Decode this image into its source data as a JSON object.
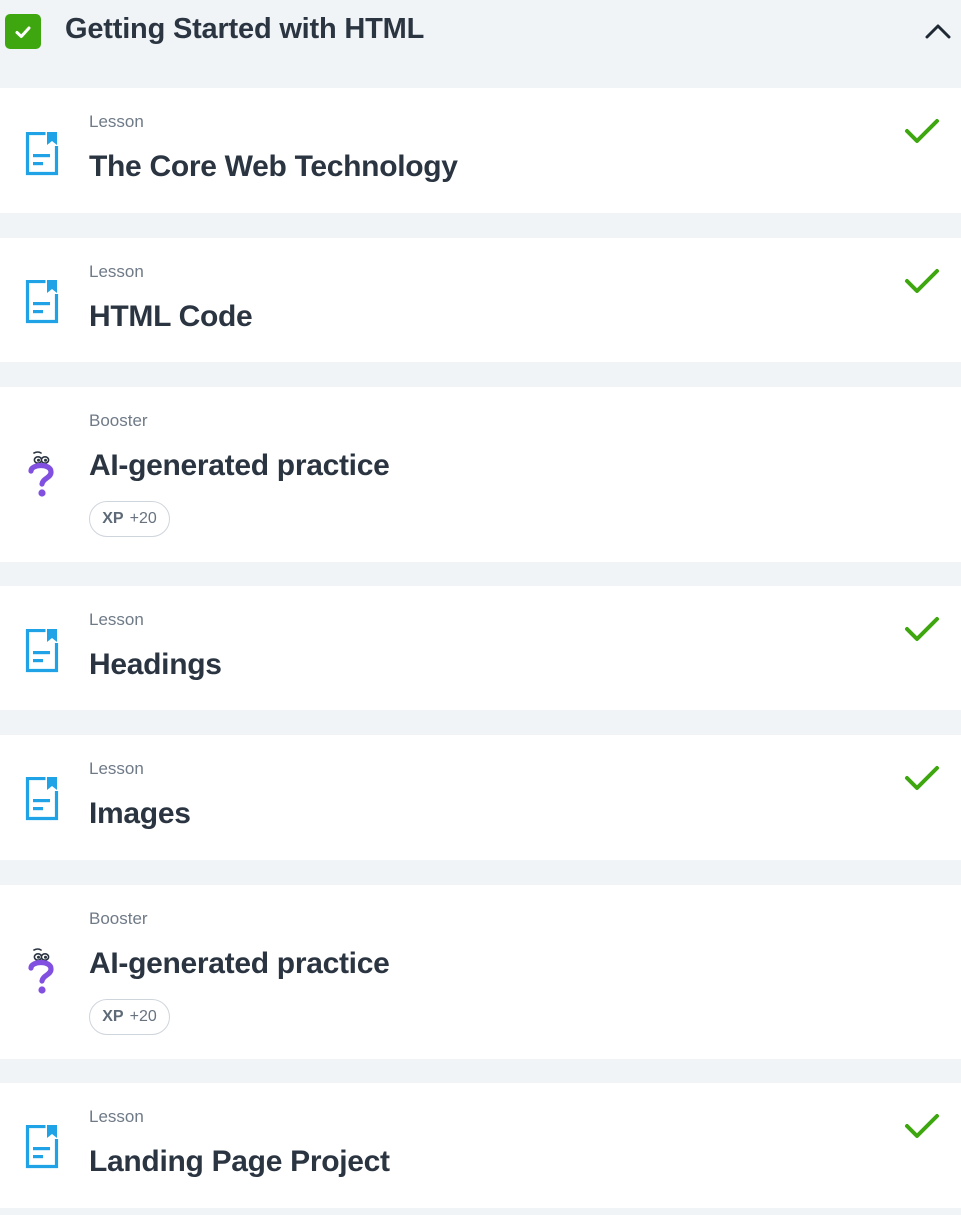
{
  "module": {
    "title": "Getting Started with HTML",
    "completed": true,
    "accent_color": "#3ea70f",
    "toggle_icon": "chevron-up-icon"
  },
  "items": [
    {
      "type": "Lesson",
      "title": "The Core Web Technology",
      "icon": "lesson-document-icon",
      "completed": true
    },
    {
      "type": "Lesson",
      "title": "HTML Code",
      "icon": "lesson-document-icon",
      "completed": true
    },
    {
      "type": "Booster",
      "title": "AI-generated practice",
      "icon": "question-mark-icon",
      "xp_label": "XP",
      "xp_value": "+20"
    },
    {
      "type": "Lesson",
      "title": "Headings",
      "icon": "lesson-document-icon",
      "completed": true
    },
    {
      "type": "Lesson",
      "title": "Images",
      "icon": "lesson-document-icon",
      "completed": true
    },
    {
      "type": "Booster",
      "title": "AI-generated practice",
      "icon": "question-mark-icon",
      "xp_label": "XP",
      "xp_value": "+20"
    },
    {
      "type": "Lesson",
      "title": "Landing Page Project",
      "icon": "lesson-document-icon",
      "completed": true
    }
  ],
  "colors": {
    "lesson_icon": "#1fa3e6",
    "booster_icon": "#8150e0",
    "check": "#3ea70f",
    "page_background": "#f1f4f7"
  }
}
